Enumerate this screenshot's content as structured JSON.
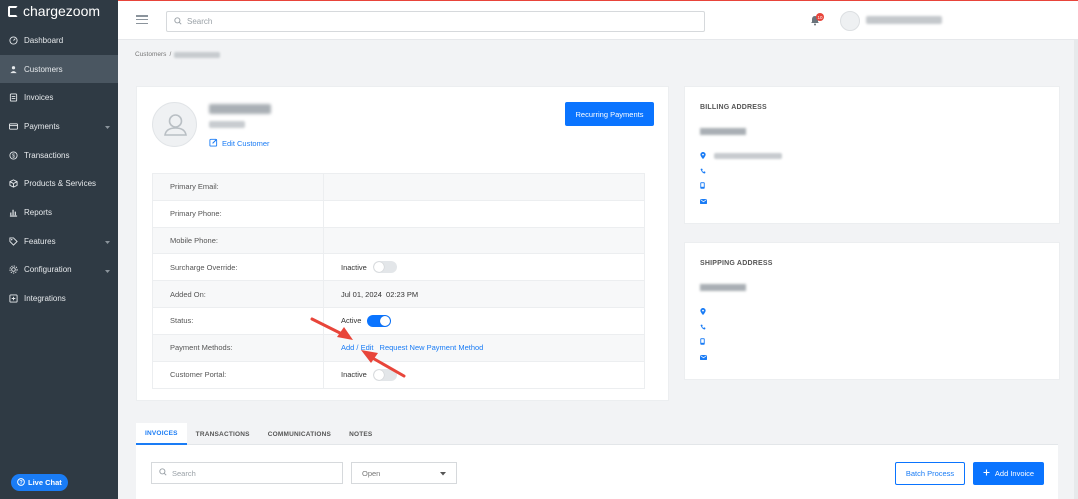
{
  "brand": {
    "name": "chargezoom"
  },
  "sidebar": {
    "items": [
      {
        "label": "Dashboard",
        "icon": "speedometer-icon",
        "expandable": false
      },
      {
        "label": "Customers",
        "icon": "users-icon",
        "expandable": false,
        "active": true
      },
      {
        "label": "Invoices",
        "icon": "invoice-icon",
        "expandable": false
      },
      {
        "label": "Payments",
        "icon": "card-icon",
        "expandable": true
      },
      {
        "label": "Transactions",
        "icon": "dollar-icon",
        "expandable": false
      },
      {
        "label": "Products & Services",
        "icon": "box-icon",
        "expandable": false
      },
      {
        "label": "Reports",
        "icon": "bar-chart-icon",
        "expandable": false
      },
      {
        "label": "Features",
        "icon": "tag-icon",
        "expandable": true
      },
      {
        "label": "Configuration",
        "icon": "gear-icon",
        "expandable": true
      },
      {
        "label": "Integrations",
        "icon": "integration-icon",
        "expandable": false
      }
    ],
    "live_chat": "Live Chat"
  },
  "topbar": {
    "search_placeholder": "Search",
    "notification_count": "10"
  },
  "breadcrumb": {
    "root": "Customers",
    "separator": "/"
  },
  "customer": {
    "edit_label": "Edit Customer",
    "recurring_button": "Recurring Payments",
    "fields": {
      "primary_email": {
        "label": "Primary Email:",
        "value": ""
      },
      "primary_phone": {
        "label": "Primary Phone:",
        "value": ""
      },
      "mobile_phone": {
        "label": "Mobile Phone:",
        "value": ""
      },
      "surcharge_override": {
        "label": "Surcharge Override:",
        "value": "Inactive",
        "toggle_on": false
      },
      "added_on": {
        "label": "Added On:",
        "value": "Jul 01, 2024  02:23 PM"
      },
      "status": {
        "label": "Status:",
        "value": "Active",
        "toggle_on": true
      },
      "payment_methods": {
        "label": "Payment Methods:",
        "add_edit": "Add / Edit",
        "request_new": "Request New Payment Method"
      },
      "customer_portal": {
        "label": "Customer Portal:",
        "value": "Inactive",
        "toggle_on": false
      }
    }
  },
  "billing": {
    "title": "BILLING ADDRESS"
  },
  "shipping": {
    "title": "SHIPPING ADDRESS"
  },
  "tabs": [
    {
      "label": "INVOICES",
      "active": true
    },
    {
      "label": "TRANSACTIONS",
      "active": false
    },
    {
      "label": "COMMUNICATIONS",
      "active": false
    },
    {
      "label": "NOTES",
      "active": false
    }
  ],
  "invoices": {
    "search_placeholder": "Search",
    "status_filter": "Open",
    "batch_process": "Batch Process",
    "add_invoice": "Add Invoice"
  },
  "colors": {
    "accent": "#0a74ff",
    "sidebar_bg": "#2f3a44",
    "annotation_arrow": "#e8453a"
  }
}
